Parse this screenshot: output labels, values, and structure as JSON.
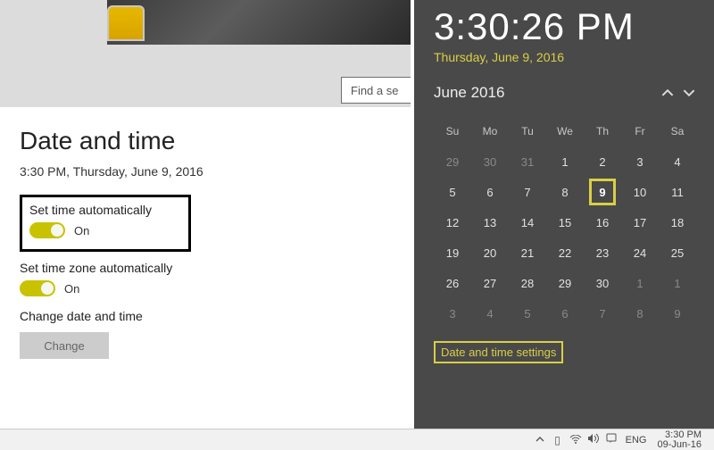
{
  "search": {
    "placeholder": "Find a se"
  },
  "settings": {
    "title": "Date and time",
    "now": "3:30 PM, Thursday, June 9, 2016",
    "autoTime": {
      "label": "Set time automatically",
      "state": "On"
    },
    "autoZone": {
      "label": "Set time zone automatically",
      "state": "On"
    },
    "changeSection": {
      "label": "Change date and time",
      "button": "Change"
    }
  },
  "flyout": {
    "time": "3:30:26 PM",
    "date": "Thursday, June 9, 2016",
    "month": "June 2016",
    "days": [
      "Su",
      "Mo",
      "Tu",
      "We",
      "Th",
      "Fr",
      "Sa"
    ],
    "weeks": [
      [
        {
          "n": "29",
          "m": true
        },
        {
          "n": "30",
          "m": true
        },
        {
          "n": "31",
          "m": true
        },
        {
          "n": "1"
        },
        {
          "n": "2"
        },
        {
          "n": "3"
        },
        {
          "n": "4"
        }
      ],
      [
        {
          "n": "5"
        },
        {
          "n": "6"
        },
        {
          "n": "7"
        },
        {
          "n": "8"
        },
        {
          "n": "9",
          "today": true
        },
        {
          "n": "10"
        },
        {
          "n": "11"
        }
      ],
      [
        {
          "n": "12"
        },
        {
          "n": "13"
        },
        {
          "n": "14"
        },
        {
          "n": "15"
        },
        {
          "n": "16"
        },
        {
          "n": "17"
        },
        {
          "n": "18"
        }
      ],
      [
        {
          "n": "19"
        },
        {
          "n": "20"
        },
        {
          "n": "21"
        },
        {
          "n": "22"
        },
        {
          "n": "23"
        },
        {
          "n": "24"
        },
        {
          "n": "25"
        }
      ],
      [
        {
          "n": "26"
        },
        {
          "n": "27"
        },
        {
          "n": "28"
        },
        {
          "n": "29"
        },
        {
          "n": "30"
        },
        {
          "n": "1",
          "m": true
        },
        {
          "n": "1",
          "m": true
        }
      ],
      [
        {
          "n": "3",
          "m": true
        },
        {
          "n": "4",
          "m": true
        },
        {
          "n": "5",
          "m": true
        },
        {
          "n": "6",
          "m": true
        },
        {
          "n": "7",
          "m": true
        },
        {
          "n": "8",
          "m": true
        },
        {
          "n": "9",
          "m": true
        }
      ]
    ],
    "link": "Date and time settings"
  },
  "taskbar": {
    "lang": "ENG",
    "time": "3:30 PM",
    "date": "09-Jun-16"
  }
}
